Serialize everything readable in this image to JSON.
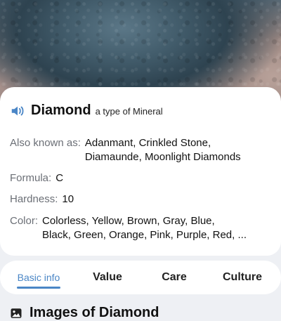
{
  "mineral": {
    "name": "Diamond",
    "type_label": "a type of Mineral",
    "speaker_icon": "speaker-icon",
    "accent_color": "#4a86c6"
  },
  "details": {
    "aka_label": "Also known as:",
    "aka_value_line1": "Adanmant, Crinkled Stone,",
    "aka_value_line2": "Diamaunde, Moonlight Diamonds",
    "formula_label": "Formula:",
    "formula_value": "C",
    "hardness_label": "Hardness:",
    "hardness_value": "10",
    "color_label": "Color:",
    "color_value_line1": "Colorless, Yellow, Brown, Gray, Blue,",
    "color_value_line2": "Black, Green, Orange, Pink, Purple, Red, ..."
  },
  "tabs": [
    {
      "label": "Basic info",
      "active": true
    },
    {
      "label": "Value",
      "active": false
    },
    {
      "label": "Care",
      "active": false
    },
    {
      "label": "Culture",
      "active": false
    }
  ],
  "section": {
    "title": "Images of Diamond",
    "icon": "image-gallery-icon"
  }
}
